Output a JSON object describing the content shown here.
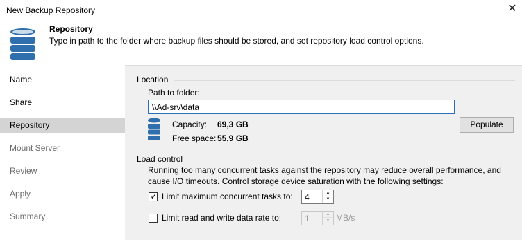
{
  "window": {
    "title": "New Backup Repository",
    "close_symbol": "✕"
  },
  "header": {
    "title": "Repository",
    "description": "Type in path to the folder where backup files should be stored, and set repository load control options.",
    "icon": "database-icon"
  },
  "sidebar": {
    "items": [
      {
        "label": "Name",
        "state": "normal"
      },
      {
        "label": "Share",
        "state": "normal"
      },
      {
        "label": "Repository",
        "state": "active"
      },
      {
        "label": "Mount Server",
        "state": "dim"
      },
      {
        "label": "Review",
        "state": "dim"
      },
      {
        "label": "Apply",
        "state": "dim"
      },
      {
        "label": "Summary",
        "state": "dim"
      }
    ]
  },
  "location": {
    "group_label": "Location",
    "path_label": "Path to folder:",
    "path_value": "\\\\Ad-srv\\data",
    "capacity_label": "Capacity:",
    "capacity_value": "69,3 GB",
    "free_label": "Free space:",
    "free_value": "55,9 GB",
    "populate_label": "Populate"
  },
  "load_control": {
    "group_label": "Load control",
    "description": "Running too many concurrent tasks against the repository may reduce overall performance, and cause I/O timeouts. Control storage device saturation with the following settings:",
    "limit_tasks": {
      "label": "Limit maximum concurrent tasks to:",
      "checked": true,
      "value": "4"
    },
    "limit_rate": {
      "label": "Limit read and write data rate to:",
      "checked": false,
      "value": "1",
      "unit": "MB/s"
    }
  },
  "colors": {
    "accent": "#2a6fb8",
    "icon_blue": "#2f6fad",
    "panel_bg": "#f0f0f0",
    "active_item_bg": "#d4d4d4"
  }
}
